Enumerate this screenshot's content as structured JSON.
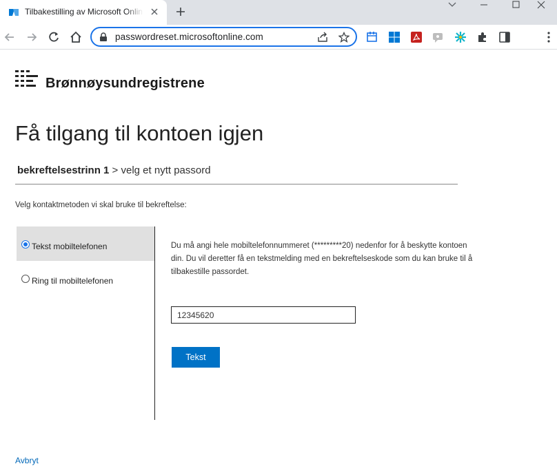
{
  "browser": {
    "tab_title": "Tilbakestilling av Microsoft Online",
    "url": "passwordreset.microsoftonline.com"
  },
  "page": {
    "logo_text": "Brønnøysundregistrene",
    "heading": "Få tilgang til kontoen igjen",
    "step_current": "bekreftelsestrinn 1",
    "step_separator": " > ",
    "step_next": "velg et nytt passord",
    "intro": "Velg kontaktmetoden vi skal bruke til bekreftelse:",
    "methods": [
      {
        "label": "Tekst mobiltelefonen",
        "selected": true
      },
      {
        "label": "Ring til mobiltelefonen",
        "selected": false
      }
    ],
    "description": "Du må angi hele mobiltelefonnummeret (*********20) nedenfor for å beskytte kontoen din. Du vil deretter få en tekstmelding med en bekreftelseskode som du kan bruke til å tilbakestille passordet.",
    "phone_value": "12345620",
    "send_button": "Tekst",
    "cancel_link": "Avbryt"
  },
  "colors": {
    "accent": "#0072c6",
    "link": "#0067b8",
    "selected_bg": "#e0e0e0"
  }
}
